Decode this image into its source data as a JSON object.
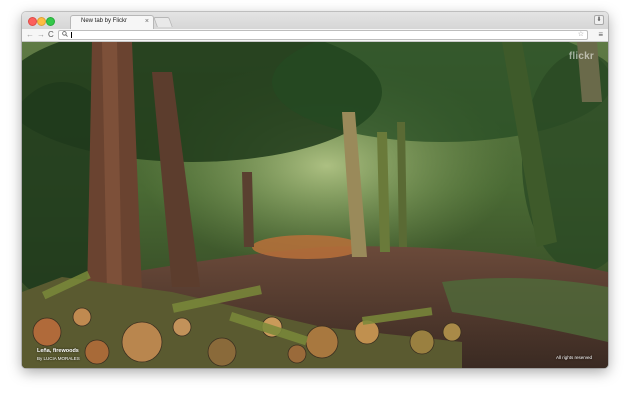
{
  "tab": {
    "title": "New tab by Flickr",
    "close_glyph": "×"
  },
  "toolbar": {
    "back_glyph": "←",
    "forward_glyph": "→",
    "reload_glyph": "C",
    "search_glyph": "🔍",
    "url_value": "",
    "star_glyph": "☆",
    "menu_glyph": "≡",
    "download_glyph": "⬇"
  },
  "icons": {
    "back": "back-arrow-icon",
    "forward": "forward-arrow-icon",
    "reload": "reload-icon",
    "search": "search-icon",
    "star": "bookmark-star-icon",
    "menu": "menu-icon",
    "download": "download-icon"
  },
  "photo": {
    "logo_text": "flickr",
    "title": "Leña, firewoods",
    "byline": "By LUCIA MORALES",
    "rights": "All rights reserved"
  },
  "colors": {
    "close_light": "#fc605c",
    "minimize_light": "#fdbc40",
    "maximize_light": "#34c84a"
  }
}
